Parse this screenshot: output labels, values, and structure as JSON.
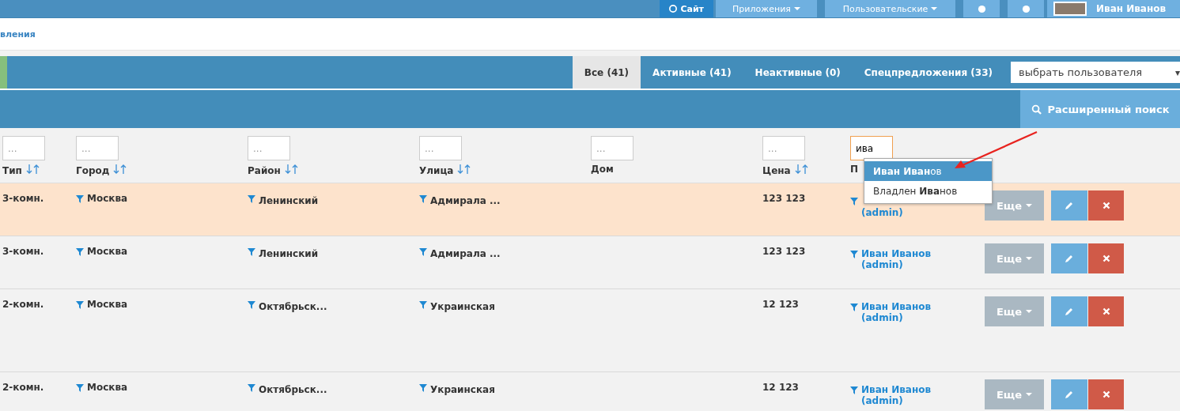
{
  "top_nav": {
    "site_button": "Сайт",
    "menus": [
      "Приложения",
      "Пользовательские"
    ],
    "user_name": "Иван Иванов"
  },
  "breadcrumb": "вления",
  "status_tabs": [
    {
      "label": "Все (41)",
      "selected": true
    },
    {
      "label": "Активные (41)",
      "selected": false
    },
    {
      "label": "Неактивные (0)",
      "selected": false
    },
    {
      "label": "Спецпредложения (33)",
      "selected": false
    }
  ],
  "user_select": {
    "value": "выбрать пользователя",
    "arrow": "▾"
  },
  "advanced_search_button": "Расширенный поиск",
  "table": {
    "columns": [
      {
        "label": "Тип",
        "sortable": true,
        "filter_placeholder": "..."
      },
      {
        "label": "Город",
        "sortable": true,
        "filter_placeholder": "..."
      },
      {
        "label": "Район",
        "sortable": true,
        "filter_placeholder": "..."
      },
      {
        "label": "Улица",
        "sortable": true,
        "filter_placeholder": "..."
      },
      {
        "label": "Дом",
        "sortable": false,
        "filter_placeholder": "..."
      },
      {
        "label": "Цена",
        "sortable": true,
        "filter_placeholder": "..."
      },
      {
        "label": "П",
        "sortable": false,
        "filter_value": "ива"
      }
    ],
    "rows": [
      {
        "highlighted": true,
        "tall": false,
        "type": "3-комн.",
        "city": "Москва",
        "district": "Ленинский",
        "street": "Адмирала ...",
        "price": "123 123",
        "user_role": "(admin)",
        "more_button": "Еще"
      },
      {
        "highlighted": false,
        "tall": false,
        "type": "3-комн.",
        "city": "Москва",
        "district": "Ленинский",
        "street": "Адмирала ...",
        "price": "123 123",
        "user_name": "Иван Иванов",
        "user_role": "(admin)",
        "more_button": "Еще"
      },
      {
        "highlighted": false,
        "tall": true,
        "type": "2-комн.",
        "city": "Москва",
        "district": "Октябрьск...",
        "street": "Украинская",
        "price": "12 123",
        "user_name": "Иван Иванов",
        "user_role": "(admin)",
        "more_button": "Еще"
      },
      {
        "highlighted": false,
        "tall": false,
        "type": "2-комн.",
        "city": "Москва",
        "district": "Октябрьск...",
        "street": "Украинская",
        "price": "12 123",
        "user_name": "Иван Иванов",
        "user_role": "(admin)",
        "more_button": "Еще"
      }
    ]
  },
  "autocomplete": [
    {
      "label": "**Иван Иван**ов",
      "selected": true
    },
    {
      "label": "Владлен **Ива**нов",
      "selected": false
    }
  ]
}
